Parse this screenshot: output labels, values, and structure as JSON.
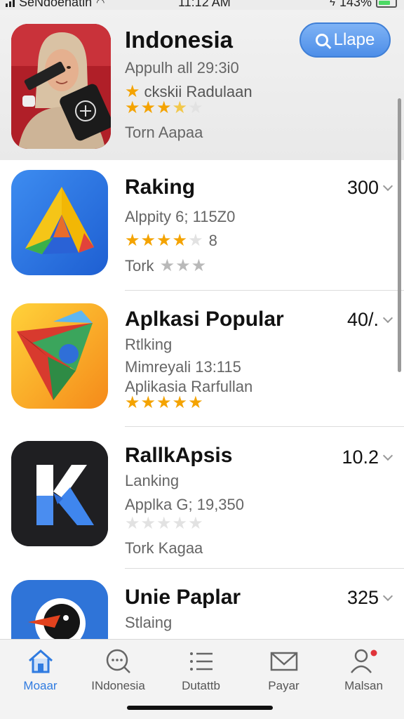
{
  "status": {
    "carrier": "SeNdoenatin",
    "time": "11:12 AM",
    "battery": "143%"
  },
  "featured": {
    "title": "Indonesia",
    "subtitle": "Appulh all 29:3i0",
    "tag": "ckskii Radulaan",
    "rating": 3.5,
    "footer": "Torn Aapaa",
    "search_label": "Llape",
    "icon": "person-holding-device-icon"
  },
  "apps": [
    {
      "title": "Raking",
      "line1": "Alppity 6; 115Z0",
      "rating_count": "8",
      "rating": 4,
      "line3": "Tork",
      "value": "300",
      "icon": "yellow-a-triangle-icon"
    },
    {
      "title": "Aplkasi Popular",
      "line1": "Rtlking",
      "line2": "Mimreyali 13:115",
      "line3": "Aplikasia Rarfullan",
      "rating": 5,
      "value": "40/.",
      "icon": "colorful-folded-shape-icon"
    },
    {
      "title": "RallkApsis",
      "line1": "Lanking",
      "line2": "Applka G; 19,350",
      "rating": 0,
      "line3": "Tork Kagaa",
      "value": "10.2",
      "icon": "blue-k-letter-icon"
    },
    {
      "title": "Unie Paplar",
      "line1": "Stlaing",
      "value": "325",
      "icon": "bird-logo-icon"
    }
  ],
  "tabs": [
    {
      "label": "Moaar",
      "icon": "home-icon",
      "active": true
    },
    {
      "label": "INdonesia",
      "icon": "chat-search-icon"
    },
    {
      "label": "Dutattb",
      "icon": "list-icon"
    },
    {
      "label": "Payar",
      "icon": "mail-icon"
    },
    {
      "label": "Malsan",
      "icon": "person-icon"
    }
  ],
  "colors": {
    "accent": "#2f7be0",
    "star": "#f4a300",
    "notification_dot": "#e0343a"
  }
}
